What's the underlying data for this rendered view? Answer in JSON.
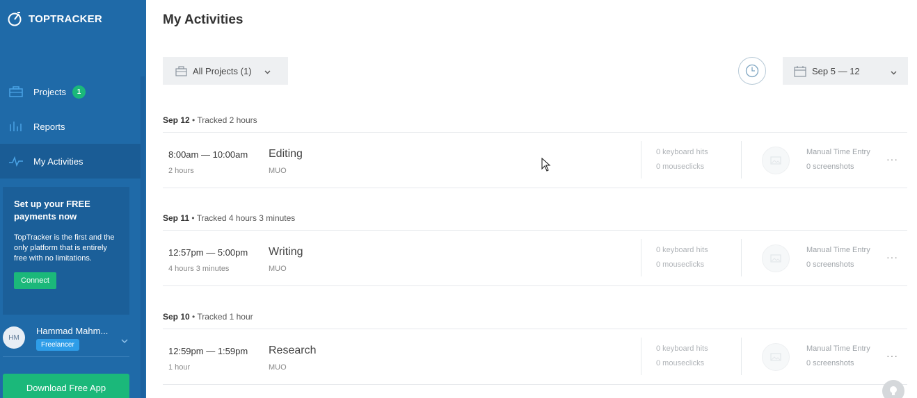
{
  "app": {
    "name": "TOPTRACKER"
  },
  "sidebar": {
    "nav": [
      {
        "label": "Projects",
        "badge": "1"
      },
      {
        "label": "Reports"
      },
      {
        "label": "My Activities"
      }
    ],
    "promo": {
      "title": "Set up your FREE payments now",
      "body": "TopTracker is the first and the only platform that is entirely free with no limitations.",
      "button": "Connect"
    },
    "user": {
      "initials": "HM",
      "name": "Hammad Mahm...",
      "role": "Freelancer"
    },
    "download": "Download Free App"
  },
  "main": {
    "title": "My Activities",
    "project_filter": "All Projects (1)",
    "date_range": "Sep 5 — 12"
  },
  "days": [
    {
      "date": "Sep 12",
      "tracked": "Tracked 2 hours",
      "entry": {
        "time": "8:00am — 10:00am",
        "duration": "2 hours",
        "task": "Editing",
        "project": "MUO",
        "keyboard": "0 keyboard hits",
        "mouse": "0 mouseclicks",
        "manual": "Manual Time Entry",
        "screenshots": "0 screenshots"
      }
    },
    {
      "date": "Sep 11",
      "tracked": "Tracked 4 hours 3 minutes",
      "entry": {
        "time": "12:57pm — 5:00pm",
        "duration": "4 hours 3 minutes",
        "task": "Writing",
        "project": "MUO",
        "keyboard": "0 keyboard hits",
        "mouse": "0 mouseclicks",
        "manual": "Manual Time Entry",
        "screenshots": "0 screenshots"
      }
    },
    {
      "date": "Sep 10",
      "tracked": "Tracked 1 hour",
      "entry": {
        "time": "12:59pm — 1:59pm",
        "duration": "1 hour",
        "task": "Research",
        "project": "MUO",
        "keyboard": "0 keyboard hits",
        "mouse": "0 mouseclicks",
        "manual": "Manual Time Entry",
        "screenshots": "0 screenshots"
      }
    }
  ],
  "more_glyph": "···"
}
